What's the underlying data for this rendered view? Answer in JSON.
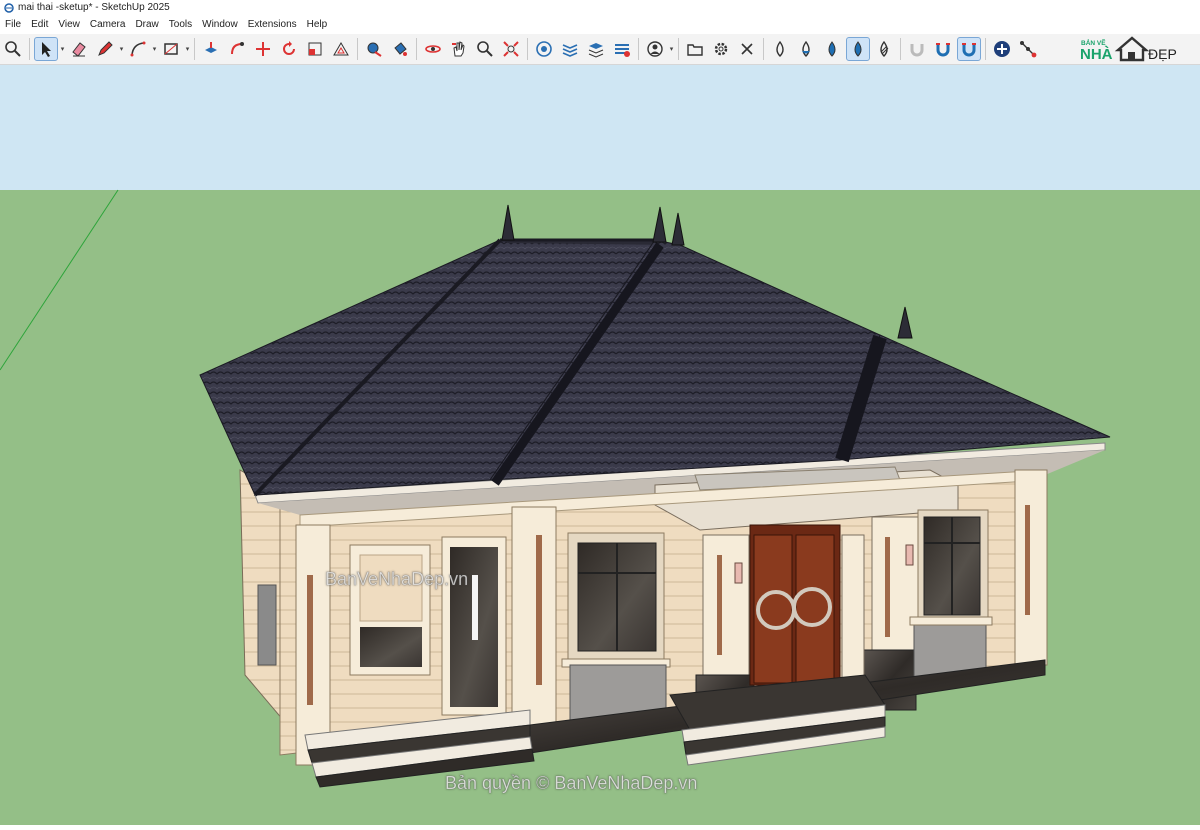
{
  "window": {
    "title": "mai thai -sketup* - SketchUp 2025"
  },
  "menu": [
    "File",
    "Edit",
    "View",
    "Camera",
    "Draw",
    "Tools",
    "Window",
    "Extensions",
    "Help"
  ],
  "toolbar": {
    "tools": [
      "search-tool",
      "select-tool",
      "eraser-tool",
      "pencil-tool",
      "line-tool",
      "rectangle-tool",
      "push-pull-tool",
      "follow-me-tool",
      "move-tool",
      "rotate-tool",
      "scale-tool",
      "offset-tool",
      "tape-tool",
      "paint-tool",
      "orbit-tool",
      "pan-tool",
      "zoom-tool",
      "zoom-extents-tool",
      "section-tool",
      "layers-tool",
      "components-tool",
      "materials-tool",
      "user-tool",
      "folder-tool",
      "settings-tool",
      "close-tool",
      "drop-1-tool",
      "drop-2-tool",
      "drop-3-tool",
      "drop-4-tool",
      "drop-5-tool",
      "magnet-1-tool",
      "magnet-2-tool",
      "magnet-3-tool",
      "add-tool",
      "path-tool"
    ]
  },
  "logo": {
    "top": "BẢN VẼ",
    "left": "NHÀ",
    "right": "ĐẸP"
  },
  "watermarks": {
    "center": "BanVeNhaDep.vn",
    "bottom": "Bản quyền © BanVeNhaDep.vn"
  },
  "colors": {
    "sky": "#cfe6f3",
    "ground": "#94bf87",
    "roof": "#3a3a4a",
    "wall": "#efdcc0",
    "trim": "#f6ecd9",
    "door": "#8a3a1e",
    "dark_stone": "#4a4540"
  }
}
